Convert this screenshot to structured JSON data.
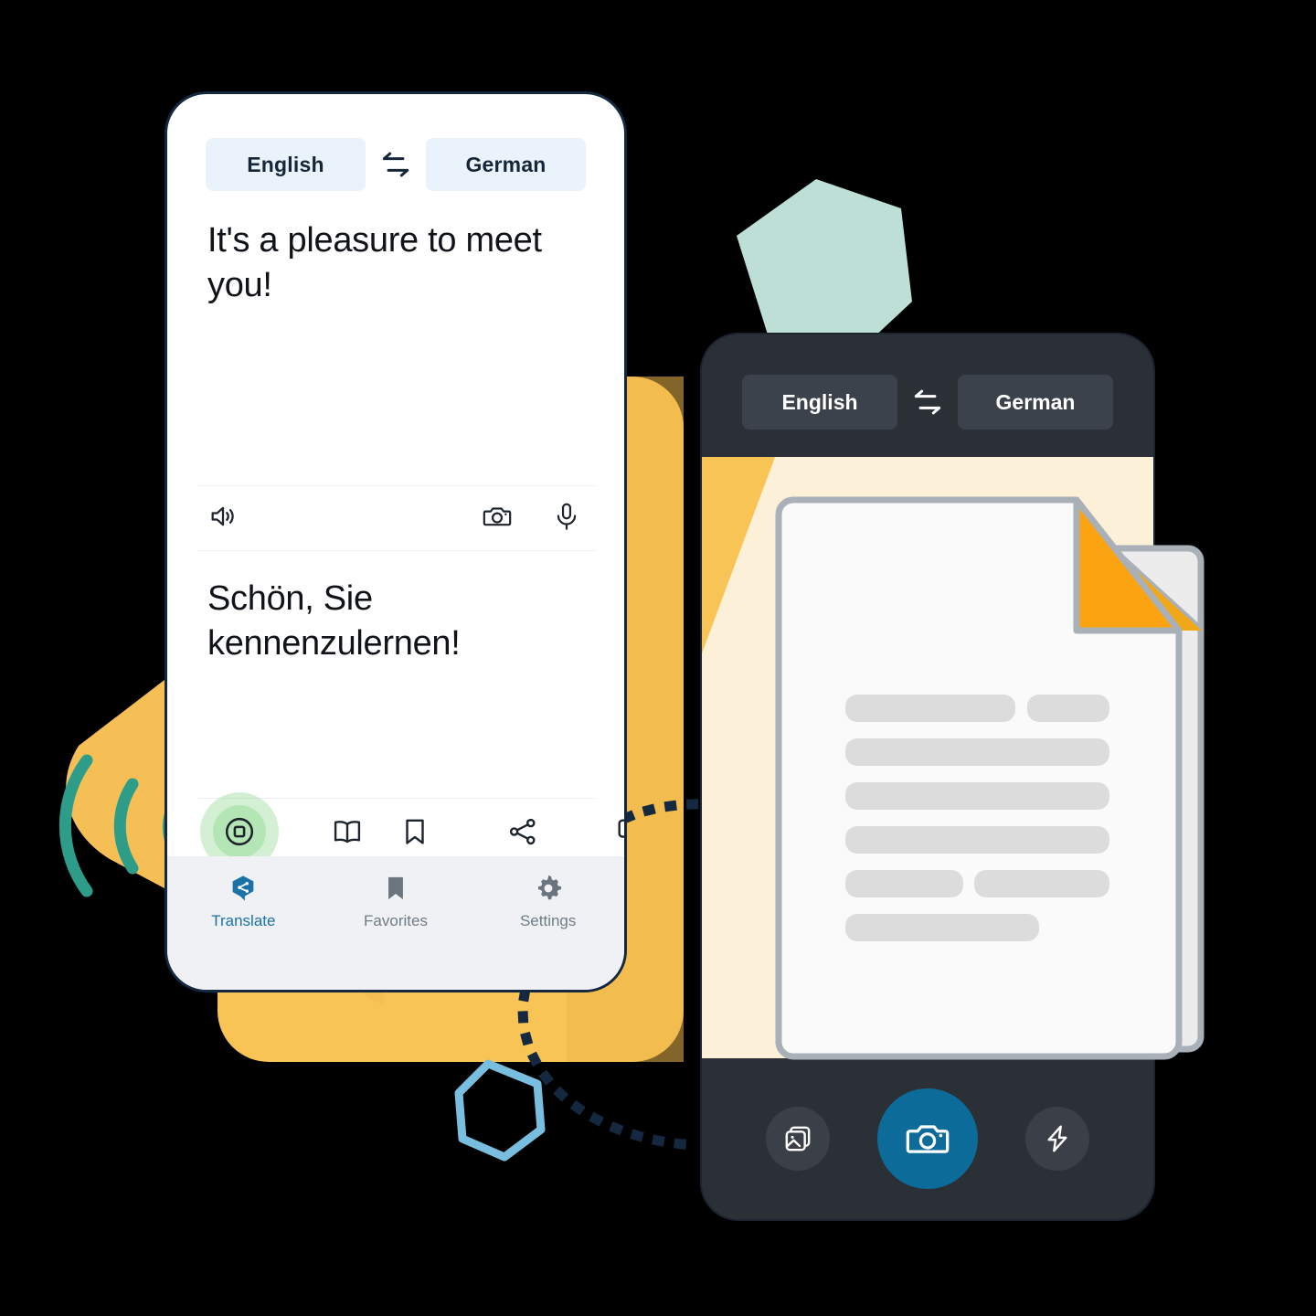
{
  "left_phone": {
    "source_lang": "English",
    "target_lang": "German",
    "swap_icon": "swap-horizontal-icon",
    "source_text": "It's a pleasure to meet you!",
    "target_text": "Schön, Sie kennenzulernen!",
    "middle_icons": {
      "speaker": "speaker-icon",
      "camera": "camera-icon",
      "microphone": "microphone-icon"
    },
    "action_icons": {
      "stop": "stop-record-icon",
      "dictionary": "open-book-icon",
      "bookmark": "bookmark-icon",
      "share": "share-icon",
      "copy": "copy-icon"
    },
    "tabs": [
      {
        "label": "Translate",
        "icon": "translate-logo-icon",
        "active": true
      },
      {
        "label": "Favorites",
        "icon": "bookmark-filled-icon",
        "active": false
      },
      {
        "label": "Settings",
        "icon": "gear-icon",
        "active": false
      }
    ]
  },
  "right_phone": {
    "source_lang": "English",
    "target_lang": "German",
    "swap_icon": "swap-horizontal-icon",
    "camera_controls": {
      "gallery": "gallery-icon",
      "shutter": "camera-shutter-icon",
      "flash": "flash-icon"
    }
  },
  "colors": {
    "accent_blue": "#0d6b9a",
    "yellow": "#f9c456",
    "yellow_dark": "#eeb74b",
    "orange": "#fca311",
    "teal": "#2d9d8a",
    "mint": "#bedfd6",
    "light_blue": "#79bede",
    "navy": "#14293f",
    "dark_phone": "#2b2f36",
    "pill_light": "#eaf3fb",
    "pill_dark": "#3c424b",
    "cream": "#fdf0d9",
    "doc_paper": "#fafafa",
    "doc_border": "#a9b0b8",
    "doc_line": "#dcdcdc",
    "tabbar": "#f0f1f5",
    "pulse_green": "#8fd88f"
  }
}
